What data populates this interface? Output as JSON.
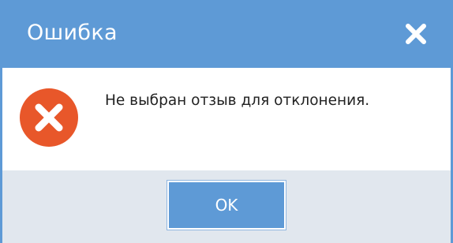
{
  "dialog": {
    "title": "Ошибка",
    "close_icon": "close-icon",
    "error_icon": "error-icon",
    "message": "Не выбран отзыв для отклонения.",
    "ok_label": "OK"
  },
  "colors": {
    "titlebar": "#5e9ad6",
    "error": "#e8572a",
    "footer": "#e1e7ee"
  }
}
